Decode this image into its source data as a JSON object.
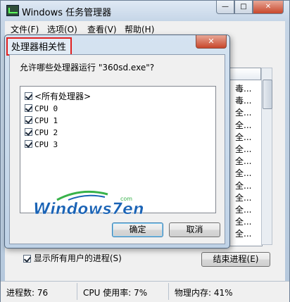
{
  "window": {
    "title": "Windows 任务管理器",
    "minimize": "—",
    "maximize": "□",
    "close": "✕"
  },
  "menu": [
    "文件(F)",
    "选项(O)",
    "查看(V)",
    "帮助(H)"
  ],
  "process_descriptions": [
    "毒...",
    "毒...",
    "全...",
    "全...",
    "全...",
    "全...",
    "全...",
    "全...",
    "全...",
    "全...",
    "全...",
    "全...",
    "全..."
  ],
  "show_all_processes": {
    "label": "显示所有用户的进程(S)",
    "checked": true
  },
  "end_process_button": "结束进程(E)",
  "status": {
    "processes": "进程数: 76",
    "cpu": "CPU 使用率: 7%",
    "memory": "物理内存: 41%"
  },
  "dialog": {
    "title": "处理器相关性",
    "close": "✕",
    "question": "允许哪些处理器运行 \"360sd.exe\"?",
    "items": [
      {
        "label": "<所有处理器>",
        "checked": true
      },
      {
        "label": "CPU 0",
        "checked": true
      },
      {
        "label": "CPU 1",
        "checked": true
      },
      {
        "label": "CPU 2",
        "checked": true
      },
      {
        "label": "CPU 3",
        "checked": true
      }
    ],
    "watermark": {
      "main": "Windows7en",
      "small": "com"
    },
    "ok": "确定",
    "cancel": "取消"
  },
  "colors": {
    "highlight_box": "#e02020",
    "close_button": "#c8472c",
    "watermark_green": "#38b24a",
    "watermark_blue": "#1a63b5"
  }
}
